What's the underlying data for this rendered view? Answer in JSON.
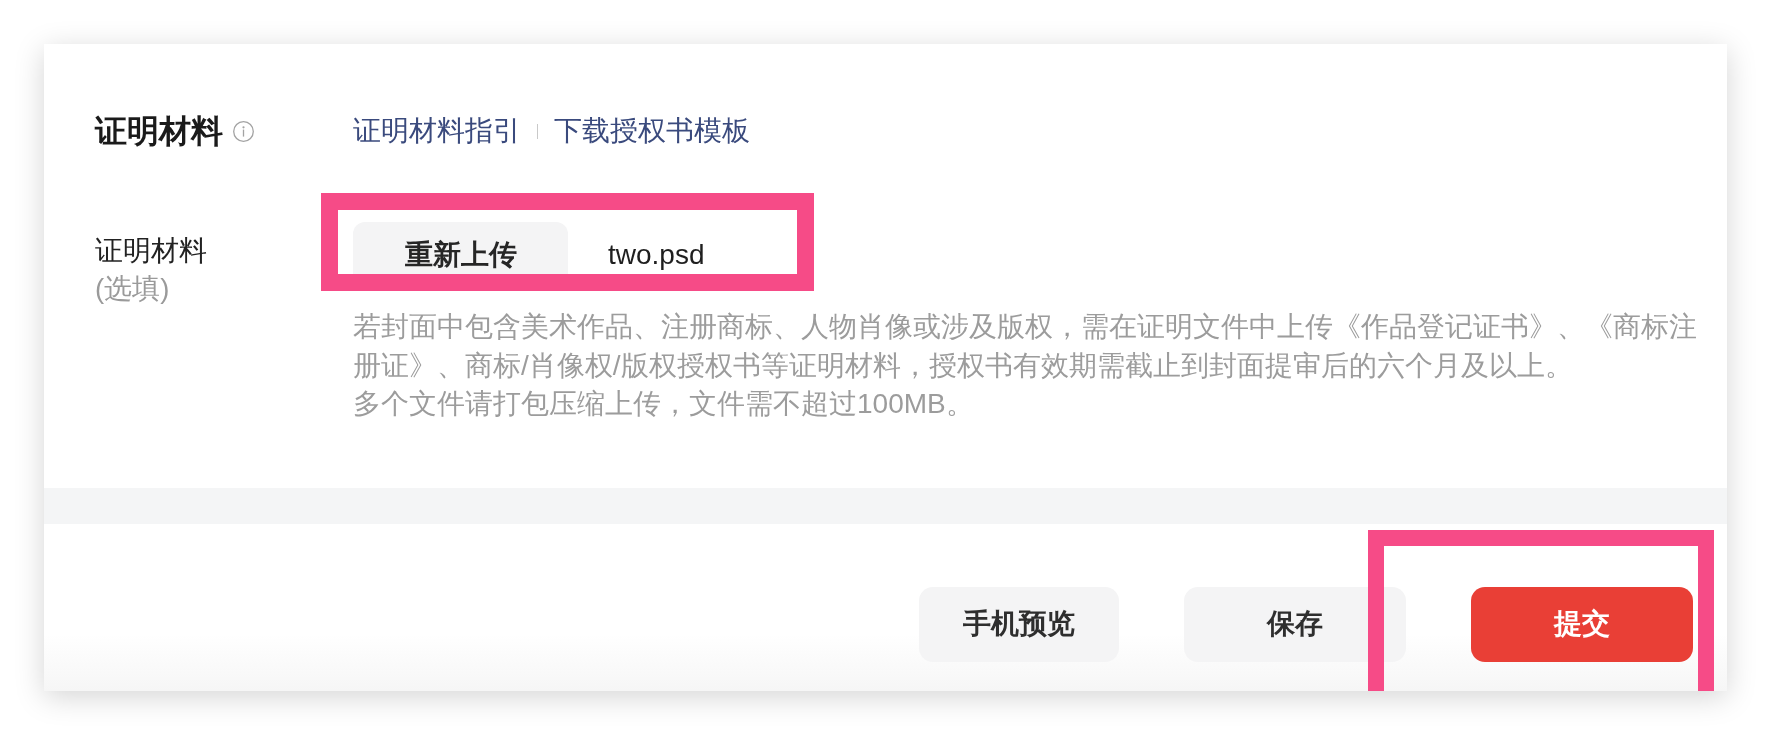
{
  "section": {
    "title": "证明材料",
    "links": [
      {
        "label": "证明材料指引"
      },
      {
        "label": "下载授权书模板"
      }
    ]
  },
  "form_field": {
    "label": "证明材料",
    "hint": "(选填)",
    "upload_button": "重新上传",
    "file_name": "two.psd",
    "highlighted": true,
    "help": [
      "若封面中包含美术作品、注册商标、人物肖像或涉及版权，需在证明文件中上传《作品登记证书》、《商标注册证》、商标/肖像权/版权授权书等证明材料，授权书有效期需截止到封面提审后的六个月及以上。",
      "多个文件请打包压缩上传，文件需不超过100MB。"
    ]
  },
  "footer": {
    "buttons": [
      {
        "label": "手机预览",
        "kind": "secondary",
        "highlighted": false
      },
      {
        "label": "保存",
        "kind": "secondary",
        "highlighted": false
      },
      {
        "label": "提交",
        "kind": "primary",
        "highlighted": true
      }
    ]
  }
}
